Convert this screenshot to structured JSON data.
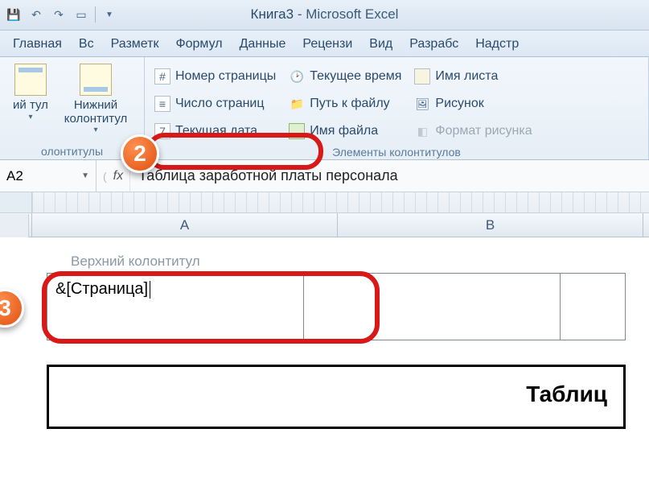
{
  "title": {
    "book": "Книга3",
    "app": "Microsoft Excel"
  },
  "tabs": [
    "Главная",
    "Вс",
    "Разметк",
    "Формул",
    "Данные",
    "Рецензи",
    "Вид",
    "Разрабс",
    "Надстр"
  ],
  "ribbon": {
    "group_hf": {
      "upper": "ий\nтул",
      "lower": "Нижний\nколонтитул",
      "label": "олонтитулы"
    },
    "group_elements": {
      "page_number": "Номер страницы",
      "page_count": "Число страниц",
      "current_date": "Текущая дата",
      "current_time": "Текущее время",
      "file_path": "Путь к файлу",
      "file_name": "Имя файла",
      "sheet_name": "Имя листа",
      "picture": "Рисунок",
      "format_picture": "Формат рисунка",
      "label": "Элементы колонтитулов"
    }
  },
  "callouts": {
    "n2": "2",
    "n3": "3"
  },
  "namebox": "A2",
  "fx": "fx",
  "formula": "Таблица заработной платы персонала",
  "columns": {
    "A": "A",
    "B": "B"
  },
  "header_area": {
    "label": "Верхний колонтитул",
    "left_value": "&[Страница]"
  },
  "doc_table_title": "Таблиц"
}
